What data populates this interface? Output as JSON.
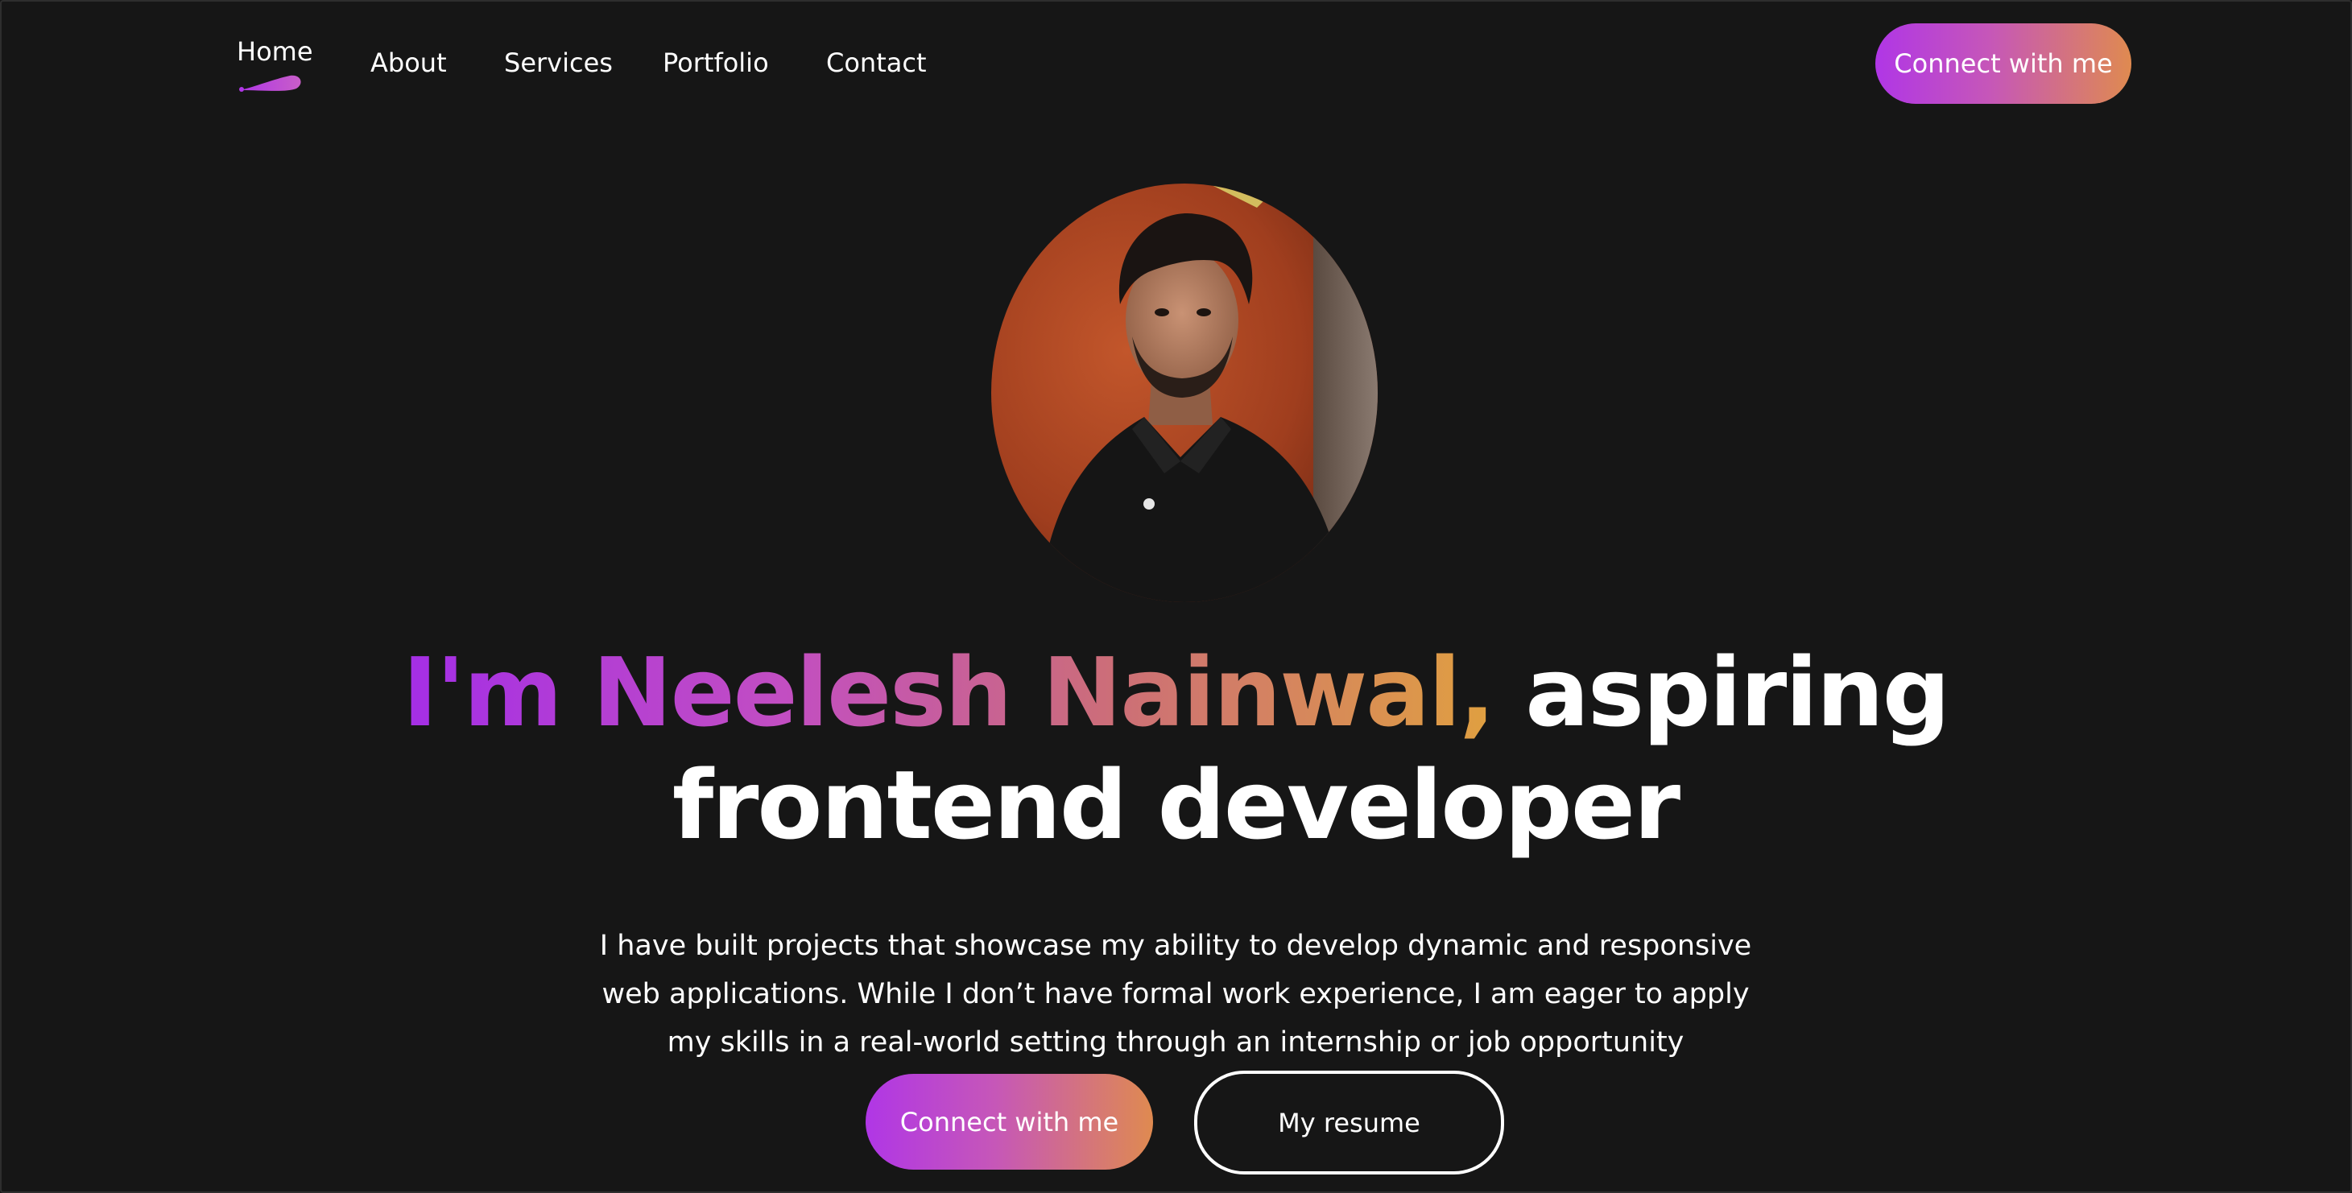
{
  "nav": {
    "items": [
      {
        "label": "Home",
        "active": true
      },
      {
        "label": "About"
      },
      {
        "label": "Services"
      },
      {
        "label": "Portfolio"
      },
      {
        "label": "Contact"
      }
    ],
    "cta_label": "Connect with me"
  },
  "hero": {
    "headline_name": "I'm Neelesh Nainwal,",
    "headline_rest_line1": " aspiring",
    "headline_rest_line2": "frontend developer",
    "description": "I have built projects that showcase my ability to develop dynamic and responsive web applications. While I don’t have formal work experience, I am eager to apply my skills in a real-world setting through an internship or job opportunity",
    "primary_cta": "Connect with me",
    "secondary_cta": "My resume"
  },
  "colors": {
    "background": "#161616",
    "gradient_start": "#b036e6",
    "gradient_end": "#df8a50",
    "text": "#ffffff"
  }
}
